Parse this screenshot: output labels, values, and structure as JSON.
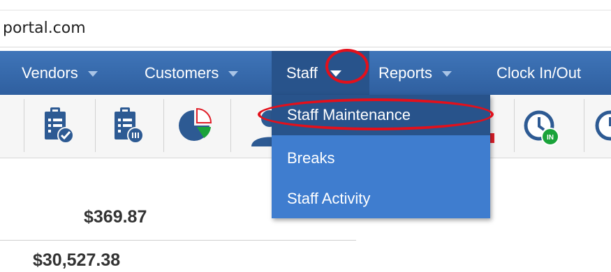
{
  "browser": {
    "url": "portal.com"
  },
  "nav": {
    "items": [
      {
        "label": "Vendors"
      },
      {
        "label": "Customers"
      },
      {
        "label": "Staff"
      },
      {
        "label": "Reports"
      },
      {
        "label": "Clock In/Out"
      }
    ]
  },
  "staff_menu": {
    "items": [
      {
        "label": "Staff Maintenance"
      },
      {
        "label": "Breaks"
      },
      {
        "label": "Staff Activity"
      }
    ]
  },
  "toolbar": {
    "icons": [
      "clipboard-check-icon",
      "clipboard-list-icon",
      "pie-chart-icon",
      "user-icon",
      "clock-in-icon",
      "clock-icon"
    ],
    "clock_in_badge": "IN"
  },
  "summary": {
    "amount_1": "$369.87",
    "amount_2": "$30,527.38"
  },
  "colors": {
    "nav_bg": "#3a6fb3",
    "nav_active": "#28538b",
    "dropdown_bg": "#3f7dcf",
    "annotation": "#e3101b",
    "badge_green": "#1aa33a"
  }
}
